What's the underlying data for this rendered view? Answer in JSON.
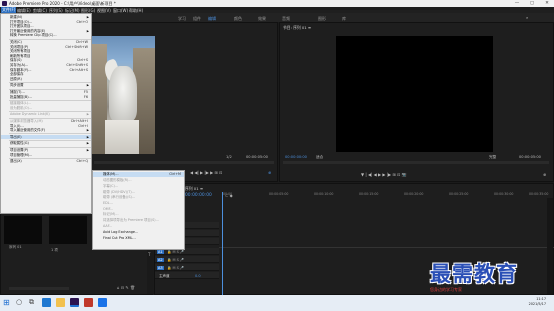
{
  "window": {
    "title": "Adobe Premiere Pro 2020 - C:\\用户\\Video\\桌面\\新项目 *",
    "minimize": "—",
    "maximize": "▢",
    "close": "✕"
  },
  "menubar": [
    "文件(F)",
    "编辑(E)",
    "剪辑(C)",
    "序列(S)",
    "标记(M)",
    "图形(G)",
    "视图(V)",
    "窗口(W)",
    "帮助(H)"
  ],
  "workspace_tabs": [
    "学习",
    "组件",
    "编辑",
    "颜色",
    "效果",
    "音频",
    "图形",
    "库"
  ],
  "source_panel": {
    "timecode": "00:00:00:00",
    "fit": "1/2",
    "duration": "00:00:05:00"
  },
  "program_panel": {
    "title": "节目: 序列 01 ≡",
    "timecode": "00:00:00:00",
    "fit": "适合",
    "quality": "完整",
    "duration": "00:00:05:00"
  },
  "file_menu": [
    {
      "label": "新建(N)",
      "sc": "",
      "arrow": true,
      "type": "item"
    },
    {
      "label": "打开项目(O)...",
      "sc": "Ctrl+O",
      "type": "item"
    },
    {
      "label": "打开团队项目...",
      "sc": "",
      "type": "item"
    },
    {
      "label": "打开最近使用的内容(E)",
      "sc": "",
      "arrow": true,
      "type": "item"
    },
    {
      "label": "转换 Premiere Clip 项目(C)...",
      "sc": "",
      "type": "item"
    },
    {
      "type": "sep"
    },
    {
      "label": "关闭(C)",
      "sc": "Ctrl+W",
      "type": "item"
    },
    {
      "label": "关闭项目(P)",
      "sc": "Ctrl+Shift+W",
      "type": "item"
    },
    {
      "label": "关闭所有项目",
      "sc": "",
      "type": "item"
    },
    {
      "label": "刷新所有项目",
      "sc": "",
      "type": "item"
    },
    {
      "label": "保存(S)",
      "sc": "Ctrl+S",
      "type": "item"
    },
    {
      "label": "另存为(A)...",
      "sc": "Ctrl+Shift+S",
      "type": "item"
    },
    {
      "label": "保存副本(Y)...",
      "sc": "Ctrl+Alt+S",
      "type": "item"
    },
    {
      "label": "全部保存",
      "sc": "",
      "type": "item"
    },
    {
      "label": "还原(R)",
      "sc": "",
      "type": "item"
    },
    {
      "type": "sep"
    },
    {
      "label": "同步设置",
      "sc": "",
      "arrow": true,
      "type": "item"
    },
    {
      "type": "sep"
    },
    {
      "label": "捕捉(T)...",
      "sc": "F5",
      "type": "item"
    },
    {
      "label": "批量捕捉(B)...",
      "sc": "F6",
      "type": "item"
    },
    {
      "type": "sep"
    },
    {
      "label": "链接媒体(L)...",
      "sc": "",
      "type": "dis"
    },
    {
      "label": "设为脱机(O)...",
      "sc": "",
      "type": "dis"
    },
    {
      "type": "sep"
    },
    {
      "label": "Adobe Dynamic Link(K)",
      "sc": "",
      "arrow": true,
      "type": "dis"
    },
    {
      "type": "sep"
    },
    {
      "label": "从媒体浏览器导入(M)",
      "sc": "Ctrl+Alt+I",
      "type": "dis"
    },
    {
      "label": "导入(I)...",
      "sc": "Ctrl+I",
      "type": "item"
    },
    {
      "label": "导入最近使用的文件(F)",
      "sc": "",
      "arrow": true,
      "type": "item"
    },
    {
      "type": "sep"
    },
    {
      "label": "导出(E)",
      "sc": "",
      "arrow": true,
      "type": "hl"
    },
    {
      "type": "sep"
    },
    {
      "label": "获取属性(G)",
      "sc": "",
      "arrow": true,
      "type": "item"
    },
    {
      "type": "sep"
    },
    {
      "label": "项目设置(P)",
      "sc": "",
      "arrow": true,
      "type": "item"
    },
    {
      "label": "项目管理(M)...",
      "sc": "",
      "type": "item"
    },
    {
      "type": "sep"
    },
    {
      "label": "退出(X)",
      "sc": "Ctrl+Q",
      "type": "item"
    }
  ],
  "export_menu": [
    {
      "label": "媒体(M)...",
      "sc": "Ctrl+M",
      "type": "hl"
    },
    {
      "label": "动态图形模板(R)...",
      "type": "dis"
    },
    {
      "label": "字幕(C)...",
      "type": "dis"
    },
    {
      "label": "磁带 (DV/HDV)(T)...",
      "type": "dis"
    },
    {
      "label": "磁带 (串行设备)(S)...",
      "type": "dis"
    },
    {
      "label": "EDL...",
      "type": "dis"
    },
    {
      "label": "OMF...",
      "type": "dis"
    },
    {
      "label": "标记(M)...",
      "type": "dis"
    },
    {
      "label": "将选择项导出为 Premiere 项目(S)...",
      "type": "dis"
    },
    {
      "label": "AAF...",
      "type": "dis"
    },
    {
      "label": "Avid Log Exchange...",
      "type": "item"
    },
    {
      "label": "Final Cut Pro XML...",
      "type": "item"
    }
  ],
  "project_panel": {
    "item_label": "序列 01",
    "item_count": "1 项"
  },
  "timeline": {
    "tab": "序列 01 ≡",
    "timecode": "00:00:00:00",
    "ruler": [
      "00:00",
      "00:00:05:00",
      "00:00:10:00",
      "00:00:15:00",
      "00:00:20:00",
      "00:00:25:00",
      "00:00:30:00",
      "00:00:35:00"
    ],
    "tracks": [
      "V3",
      "V2",
      "V1",
      "A1",
      "A2",
      "A3",
      "主声道"
    ],
    "master_value": "0.0"
  },
  "taskbar": {
    "time": "11:17",
    "date": "2021/5/17"
  },
  "watermark": {
    "main": "最需教育",
    "sub": "您身边的学习专家"
  }
}
